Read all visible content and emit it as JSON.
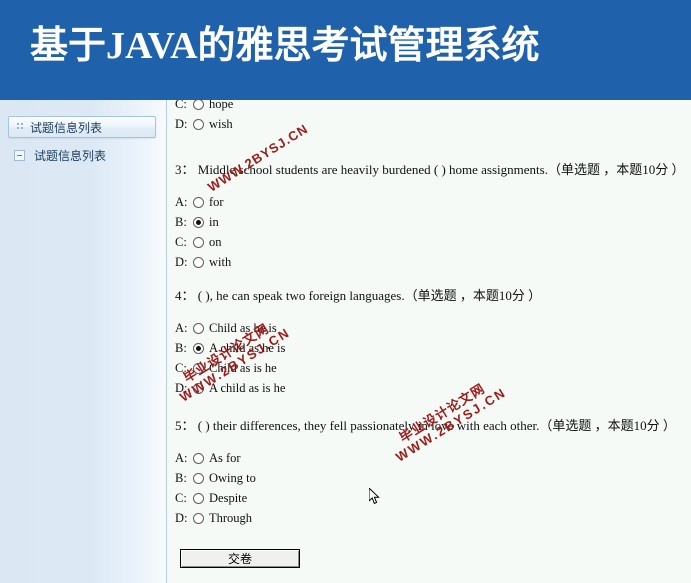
{
  "header": {
    "title": "基于JAVA的雅思考试管理系统",
    "bg_color": "#1f62ab",
    "text_color": "#ffffff"
  },
  "sidebar": {
    "panel_header": {
      "label": "试题信息列表",
      "icon": "grip-icon"
    },
    "tree_node": {
      "label": "试题信息列表",
      "icon": "expand-toggle-icon"
    }
  },
  "exam": {
    "partial_question_top": {
      "options": [
        {
          "letter": "C:",
          "text": "hope",
          "selected": false
        },
        {
          "letter": "D:",
          "text": "wish",
          "selected": false
        }
      ]
    },
    "questions": [
      {
        "number": "3：",
        "stem": "Middle school students are heavily burdened ( ) home assignments.（单选题 ，本题10分 ）",
        "options": [
          {
            "letter": "A:",
            "text": "for",
            "selected": false
          },
          {
            "letter": "B:",
            "text": "in",
            "selected": true
          },
          {
            "letter": "C:",
            "text": "on",
            "selected": false
          },
          {
            "letter": "D:",
            "text": "with",
            "selected": false
          }
        ]
      },
      {
        "number": "4：",
        "stem": "( ), he can speak two foreign languages.（单选题 ，本题10分 ）",
        "options": [
          {
            "letter": "A:",
            "text": "Child as he is",
            "selected": false
          },
          {
            "letter": "B:",
            "text": "A child as he is",
            "selected": true
          },
          {
            "letter": "C:",
            "text": "Child as is he",
            "selected": false
          },
          {
            "letter": "D:",
            "text": "A child as is he",
            "selected": false
          }
        ]
      },
      {
        "number": "5：",
        "stem": "( ) their differences, they fell passionately in love with each other.（单选题 ，本题10分 ）",
        "options": [
          {
            "letter": "A:",
            "text": "As for",
            "selected": false
          },
          {
            "letter": "B:",
            "text": "Owing to",
            "selected": false
          },
          {
            "letter": "C:",
            "text": "Despite",
            "selected": false
          },
          {
            "letter": "D:",
            "text": "Through",
            "selected": false
          }
        ]
      }
    ],
    "submit_button_label": "交卷"
  },
  "watermarks": {
    "color": "#9c1b1b",
    "line1": "毕业设计论文网",
    "line2": "WWW.2BYSJ.CN"
  }
}
